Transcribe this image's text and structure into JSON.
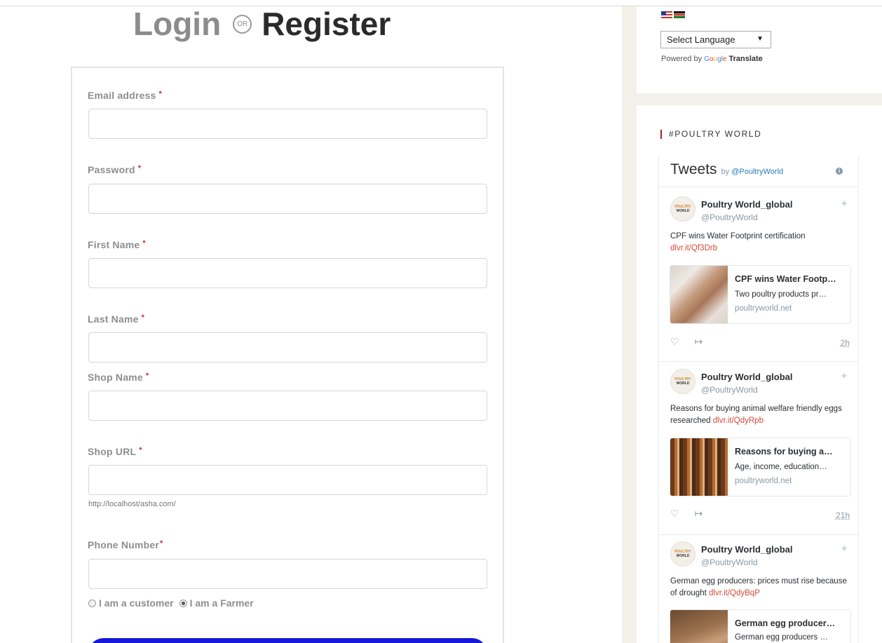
{
  "heading": {
    "login": "Login",
    "or": "OR",
    "register": "Register"
  },
  "form": {
    "email_label": "Email address",
    "password_label": "Password",
    "first_name_label": "First Name",
    "last_name_label": "Last Name",
    "shop_name_label": "Shop Name",
    "shop_url_label": "Shop URL",
    "shop_url_hint": "http://localhost/asha.com/",
    "phone_label": "Phone Number",
    "required_mark": "*",
    "role_customer": "I am a customer",
    "role_farmer": "I am a Farmer",
    "role_selected": "I am a Farmer"
  },
  "translate": {
    "select_label": "Select Language",
    "powered_by": "Powered by",
    "google": "Google",
    "translate": "Translate"
  },
  "sidebar": {
    "section_title": "#POULTRY WORLD",
    "tweets_title": "Tweets",
    "tweets_by": "by",
    "tweets_handle": "@PoultryWorld"
  },
  "tweets": [
    {
      "name": "Poultry World_global",
      "handle": "@PoultryWorld",
      "text": "CPF wins Water Footprint certification",
      "link": "dlvr.it/Qf3Drb",
      "card_title": "CPF wins Water Footp…",
      "card_desc": "Two poultry products pr…",
      "card_domain": "poultryworld.net",
      "time": "2h"
    },
    {
      "name": "Poultry World_global",
      "handle": "@PoultryWorld",
      "text": "Reasons for buying animal welfare friendly eggs researched",
      "link": "dlvr.it/QdyRpb",
      "card_title": "Reasons for buying a…",
      "card_desc": "Age, income, education…",
      "card_domain": "poultryworld.net",
      "time": "21h"
    },
    {
      "name": "Poultry World_global",
      "handle": "@PoultryWorld",
      "text": "German egg producers: prices must rise because of drought",
      "link": "dlvr.it/QdyBqP",
      "card_title": "German egg producer…",
      "card_desc": "German egg producers …"
    }
  ],
  "avatar_text": {
    "line1": "POULTRY",
    "line2": "WORLD"
  },
  "colors": {
    "brand_blue": "#1617d9",
    "required_red": "#cf2a2a",
    "accent_red": "#a5281f",
    "link_red": "#d64a3a"
  }
}
